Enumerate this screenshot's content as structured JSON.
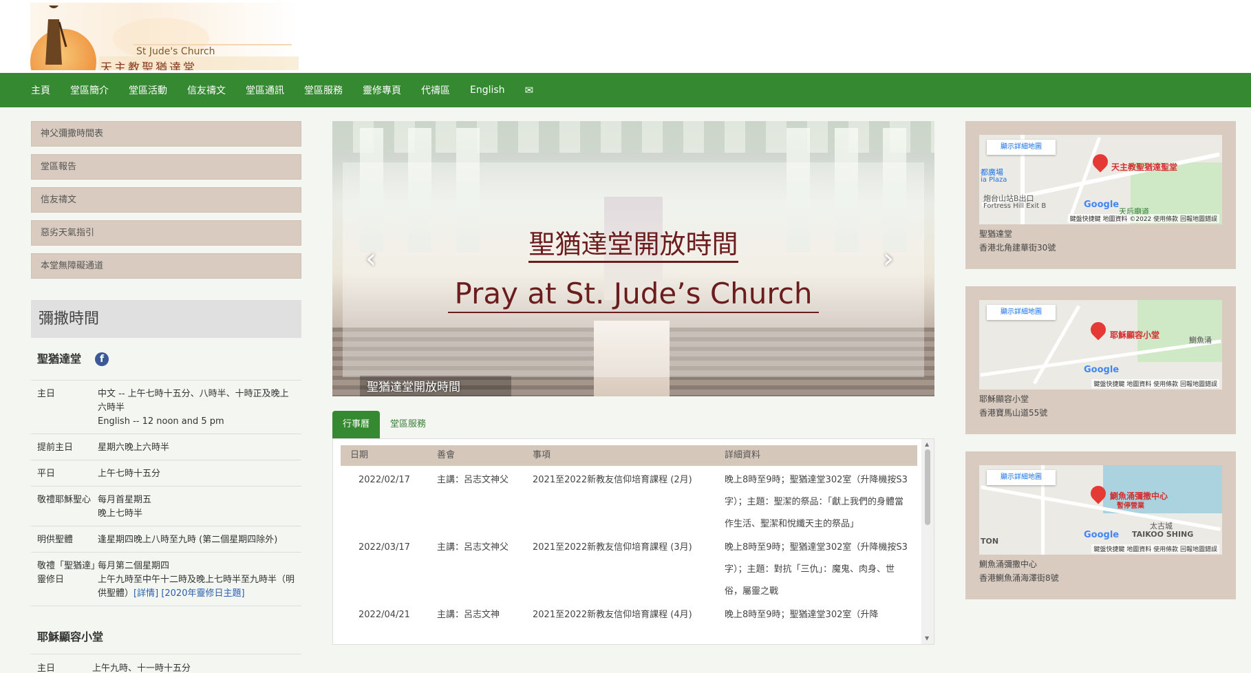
{
  "header": {
    "logo_en": "St Jude's Church",
    "logo_zh": "天主教聖猶達堂"
  },
  "nav": {
    "items": [
      "主頁",
      "堂區簡介",
      "堂區活動",
      "信友禱文",
      "堂區通訊",
      "堂區服務",
      "靈修專頁",
      "代禱區",
      "English"
    ],
    "mail_icon": "✉"
  },
  "side_links": [
    "神父彌撒時間表",
    "堂區報告",
    "信友禱文",
    "惡劣天氣指引",
    "本堂無障礙通道"
  ],
  "mass": {
    "title": "彌撒時間",
    "church_name": "聖猶達堂",
    "fb_icon": "f",
    "rows": [
      {
        "k": "主日",
        "v": "中文 -- 上午七時十五分、八時半、十時正及晚上六時半\nEnglish -- 12 noon and 5 pm"
      },
      {
        "k": "提前主日",
        "v": "星期六晚上六時半"
      },
      {
        "k": "平日",
        "v": "上午七時十五分"
      },
      {
        "k": "敬禮耶穌聖心",
        "v": "每月首星期五\n晚上七時半"
      },
      {
        "k": "明供聖體",
        "v": "逢星期四晚上八時至九時 (第二個星期四除外)"
      },
      {
        "k": "敬禮「聖猶達」靈修日",
        "v": "每月第二個星期四\n上午九時至中午十二時及晚上七時半至九時半（明供聖體）"
      }
    ],
    "links": [
      "[詳情]",
      "[2020年靈修日主題]"
    ],
    "chapel_name": "耶穌顯容小堂",
    "chapel_row": {
      "k": "主日",
      "v": "上午九時、十一時十五分"
    }
  },
  "carousel": {
    "title_zh": "聖猶達堂開放時間",
    "title_en": "Pray at St. Jude’s Church",
    "caption": "聖猶達堂開放時間",
    "prev": "‹",
    "next": "›"
  },
  "tabs": [
    "行事曆",
    "堂區服務"
  ],
  "table": {
    "headers": [
      "日期",
      "善會",
      "事項",
      "詳細資料"
    ],
    "rows": [
      {
        "date": "2022/02/17",
        "org": "主講：呂志文神父",
        "item": "2021至2022新教友信仰培育課程 (2月)",
        "detail": "晚上8時至9時；聖猶達堂302室（升降機按S3字）；主題：聖潔的祭品：「獻上我們的身體當作生活、聖潔和悅纖天主的祭品」"
      },
      {
        "date": "2022/03/17",
        "org": "主講：呂志文神父",
        "item": "2021至2022新教友信仰培育課程 (3月)",
        "detail": "晚上8時至9時；聖猶達堂302室（升降機按S3字）；主題：對抗「三仇」：魔鬼、肉身、世俗，屬靈之戰"
      },
      {
        "date": "2022/04/21",
        "org": "主講：呂志文神",
        "item": "2021至2022新教友信仰培育課程 (4月)",
        "detail": "晚上8時至9時；聖猶達堂302室（升降"
      }
    ]
  },
  "maps": [
    {
      "detail_btn": "顯示詳細地圖",
      "pin_label": "天主教聖猶達聖堂",
      "places": [
        "都廣場",
        "ia Plaza",
        "炮台山站B出口",
        "Fortress Hill Exit B",
        "天后廟道"
      ],
      "footer": "鍵盤快捷鍵  地圖資料 ©2022  使用條款  回報地圖錯誤",
      "name": "聖猶達堂",
      "address": "香港北角建華街30號"
    },
    {
      "detail_btn": "顯示詳細地圖",
      "pin_label": "耶穌顯容小堂",
      "places": [
        "鰂魚涌"
      ],
      "footer": "鍵盤快捷鍵  地圖資料  使用條款  回報地圖錯誤",
      "name": "耶穌顯容小堂",
      "address": "香港寶馬山道55號"
    },
    {
      "detail_btn": "顯示詳細地圖",
      "pin_label": "鰂魚涌彌撒中心",
      "pin_sub": "暫停營業",
      "places": [
        "太古城",
        "TAIKOO SHING",
        "TON"
      ],
      "footer": "鍵盤快捷鍵  地圖資料  使用條款  回報地圖錯誤",
      "name": "鰂魚涌彌撒中心",
      "address": "香港鰂魚涌海澤街8號"
    }
  ],
  "google_label": "Google",
  "colors": {
    "nav_green": "#358a31",
    "side_tan": "#d9cbbf",
    "title_maroon": "#6b1d1d"
  }
}
